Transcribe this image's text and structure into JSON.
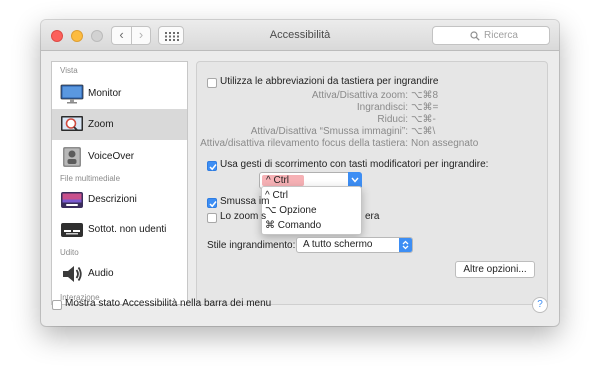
{
  "window": {
    "title": "Accessibilità",
    "search_placeholder": "Ricerca"
  },
  "sidebar": {
    "sections": [
      "Vista",
      "File multimediale",
      "Udito",
      "Interazione"
    ],
    "items": [
      {
        "label": "Monitor",
        "icon": "monitor-icon"
      },
      {
        "label": "Zoom",
        "icon": "zoom-icon",
        "selected": true
      },
      {
        "label": "VoiceOver",
        "icon": "voiceover-icon"
      },
      {
        "label": "Descrizioni",
        "icon": "descriptions-icon"
      },
      {
        "label": "Sottot. non udenti",
        "icon": "captions-icon"
      },
      {
        "label": "Audio",
        "icon": "audio-icon"
      }
    ]
  },
  "zoom": {
    "shortcuts_checkbox": "Utilizza le abbreviazioni da tastiera per ingrandire",
    "shortcuts": [
      {
        "label": "Attiva/Disattiva zoom:",
        "keys": "⌥⌘8"
      },
      {
        "label": "Ingrandisci:",
        "keys": "⌥⌘="
      },
      {
        "label": "Riduci:",
        "keys": "⌥⌘-"
      },
      {
        "label": "Attiva/Disattiva “Smussa immagini”:",
        "keys": "⌥⌘\\"
      },
      {
        "label": "Attiva/disattiva rilevamento focus della tastiera:",
        "keys": "Non assegnato"
      }
    ],
    "scroll_gesture_checkbox": "Usa gesti di scorrimento con tasti modificatori per ingrandire:",
    "modifier_value": "^ Ctrl",
    "modifier_options": [
      "^ Ctrl",
      "⌥ Opzione",
      "⌘ Comando"
    ],
    "smooth_label_visible": "Smussa im",
    "follow_label_visible": "Lo zoom s",
    "follow_label_tail": "era",
    "style_label": "Stile ingrandimento:",
    "style_value": "A tutto schermo",
    "more_options": "Altre opzioni..."
  },
  "footer": {
    "menu_status_checkbox": "Mostra stato Accessibilità nella barra dei menu",
    "help": "?"
  },
  "colors": {
    "accent": "#3d8ef4",
    "close": "#fc605b",
    "minimize": "#fdbc40",
    "highlight": "#f6b1b5"
  }
}
